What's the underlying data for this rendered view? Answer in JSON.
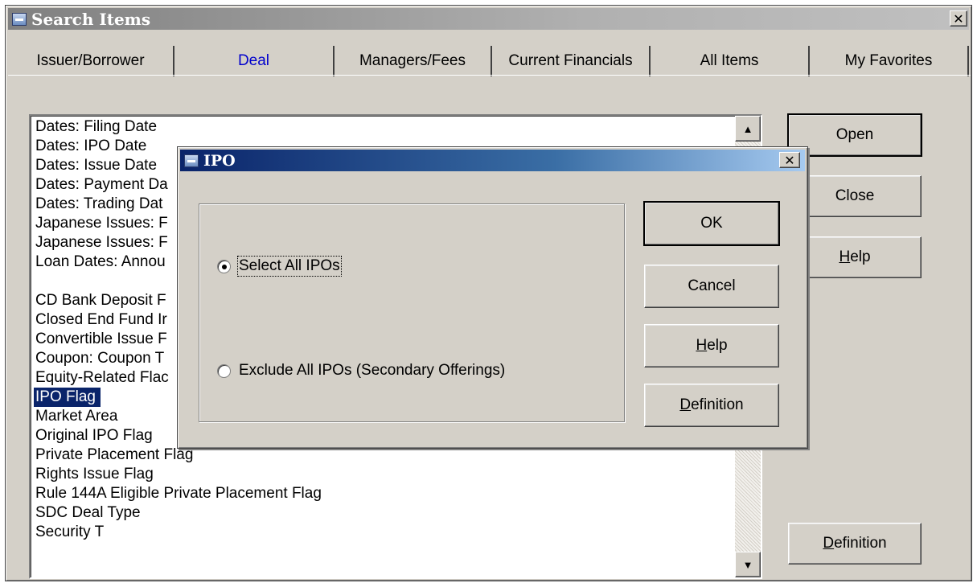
{
  "window": {
    "title": "Search Items",
    "close_glyph": "✕"
  },
  "tabs": [
    {
      "label": "Issuer/Borrower",
      "active": false
    },
    {
      "label": "Deal",
      "active": true
    },
    {
      "label": "Managers/Fees",
      "active": false
    },
    {
      "label": "Current Financials",
      "active": false
    },
    {
      "label": "All Items",
      "active": false
    },
    {
      "label": "My Favorites",
      "active": false
    }
  ],
  "list": {
    "items": [
      "Dates: Filing Date",
      "Dates: IPO Date",
      "Dates: Issue Date",
      "Dates: Payment Da",
      "Dates: Trading Dat",
      "Japanese Issues: F",
      "Japanese Issues: F",
      "Loan Dates: Annou",
      "",
      "CD Bank Deposit F",
      "Closed End Fund Ir",
      "Convertible Issue F",
      "Coupon: Coupon T",
      "Equity-Related Flac",
      "IPO Flag",
      "Market Area",
      "Original IPO Flag",
      "Private Placement Flag",
      "Rights Issue Flag",
      "Rule 144A Eligible Private Placement Flag",
      "SDC Deal Type",
      "Security T"
    ],
    "selected_index": 14,
    "scroll_up_glyph": "▲",
    "scroll_down_glyph": "▼"
  },
  "side_buttons": {
    "open": "Open",
    "close": "Close",
    "help_accel": "H",
    "help_rest": "elp",
    "definition_accel": "D",
    "definition_rest": "efinition"
  },
  "ipo_dialog": {
    "title": "IPO",
    "close_glyph": "✕",
    "options": [
      {
        "label": "Select All IPOs",
        "selected": true
      },
      {
        "label": "Exclude All IPOs (Secondary Offerings)",
        "selected": false
      }
    ],
    "ok": "OK",
    "cancel": "Cancel",
    "help_accel": "H",
    "help_rest": "elp",
    "definition_accel": "D",
    "definition_rest": "efinition"
  }
}
